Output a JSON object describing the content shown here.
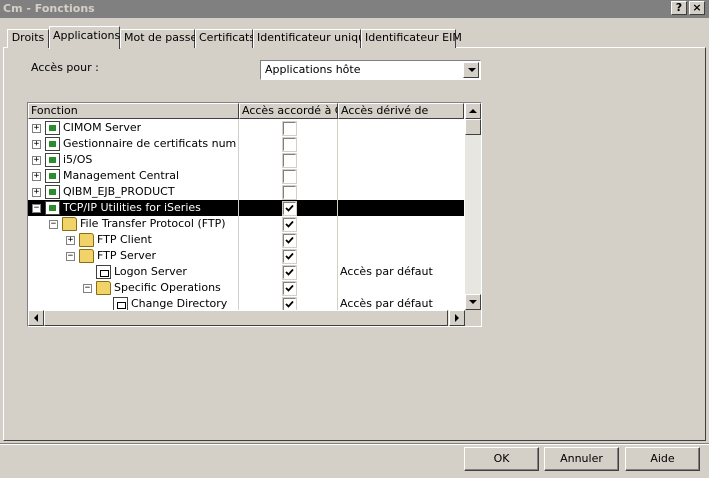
{
  "window": {
    "title": "Cm - Fonctions",
    "help_label": "?",
    "close_label": "×"
  },
  "tabs": [
    {
      "label": "Droits",
      "active": false
    },
    {
      "label": "Applications",
      "active": true
    },
    {
      "label": "Mot de passe",
      "active": false
    },
    {
      "label": "Certificats",
      "active": false
    },
    {
      "label": "Identificateur unique",
      "active": false
    },
    {
      "label": "Identificateur EIM",
      "active": false
    }
  ],
  "access": {
    "label": "Accès pour :",
    "selected": "Applications hôte"
  },
  "table": {
    "columns": [
      "Fonction",
      "Accès accordé à Cm",
      "Accès dérivé de"
    ],
    "rows": [
      {
        "label": "CIMOM Server",
        "depth": 0,
        "expander": "+",
        "icon": "component-icon",
        "checked": false,
        "derived": "",
        "selected": false
      },
      {
        "label": "Gestionnaire de certificats numériques",
        "depth": 0,
        "expander": "+",
        "icon": "component-icon",
        "checked": false,
        "derived": "",
        "selected": false
      },
      {
        "label": "i5/OS",
        "depth": 0,
        "expander": "+",
        "icon": "component-icon",
        "checked": false,
        "derived": "",
        "selected": false
      },
      {
        "label": "Management Central",
        "depth": 0,
        "expander": "+",
        "icon": "component-icon",
        "checked": false,
        "derived": "",
        "selected": false
      },
      {
        "label": "QIBM_EJB_PRODUCT",
        "depth": 0,
        "expander": "+",
        "icon": "component-icon",
        "checked": false,
        "derived": "",
        "selected": false
      },
      {
        "label": "TCP/IP Utilities for iSeries",
        "depth": 0,
        "expander": "−",
        "icon": "component-icon",
        "checked": true,
        "derived": "",
        "selected": true
      },
      {
        "label": "File Transfer Protocol (FTP)",
        "depth": 1,
        "expander": "−",
        "icon": "folder-icon",
        "checked": true,
        "derived": "",
        "selected": false
      },
      {
        "label": "FTP Client",
        "depth": 2,
        "expander": "+",
        "icon": "folder-icon",
        "checked": true,
        "derived": "",
        "selected": false
      },
      {
        "label": "FTP Server",
        "depth": 2,
        "expander": "−",
        "icon": "folder-icon",
        "checked": true,
        "derived": "",
        "selected": false
      },
      {
        "label": "Logon Server",
        "depth": 3,
        "expander": "",
        "icon": "lock-icon",
        "checked": true,
        "derived": "Accès par défaut",
        "selected": false
      },
      {
        "label": "Specific Operations",
        "depth": 3,
        "expander": "−",
        "icon": "folder-icon",
        "checked": true,
        "derived": "",
        "selected": false
      },
      {
        "label": "Change Directory",
        "depth": 4,
        "expander": "",
        "icon": "lock-icon",
        "checked": true,
        "derived": "Accès par défaut",
        "selected": false
      }
    ]
  },
  "buttons": {
    "ok": "OK",
    "cancel": "Annuler",
    "help": "Aide"
  }
}
